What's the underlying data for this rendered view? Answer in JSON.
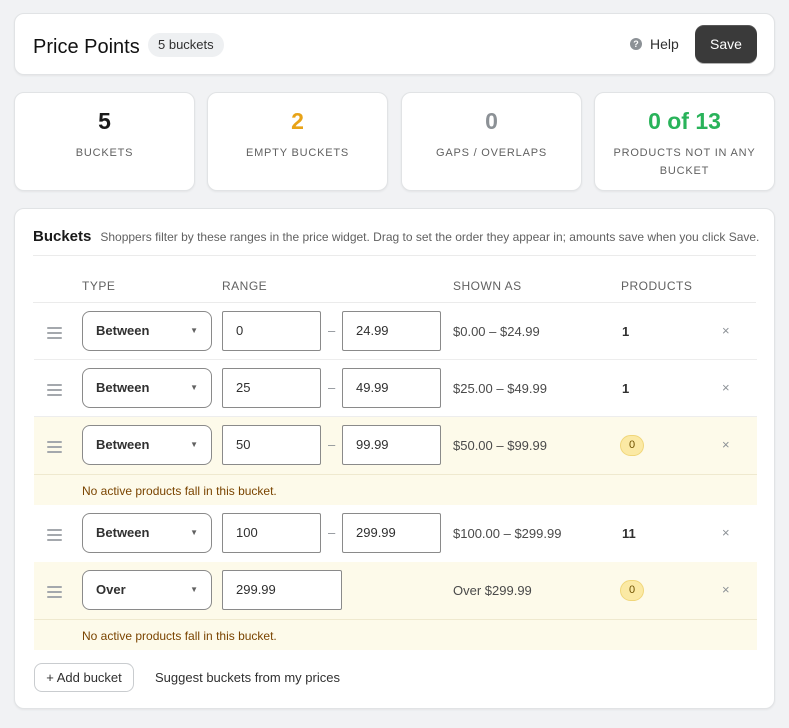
{
  "header": {
    "title": "Price Points",
    "badge": "5 buckets",
    "help_icon": "question-circle-icon",
    "help_label": "Help",
    "save_label": "Save"
  },
  "stats": [
    {
      "value": "5",
      "label": "BUCKETS",
      "color": "#1a1a1a"
    },
    {
      "value": "2",
      "label": "EMPTY BUCKETS",
      "color": "#e8a317"
    },
    {
      "value": "0",
      "label": "GAPS / OVERLAPS",
      "color": "#8c9196"
    },
    {
      "value": "0 of 13",
      "label": "PRODUCTS NOT IN ANY BUCKET",
      "color": "#29b35a"
    }
  ],
  "buckets": {
    "title": "Buckets",
    "subtitle": "Shoppers filter by these ranges in the price widget. Drag to set the order they appear in; amounts save when you click Save.",
    "columns": {
      "type": "TYPE",
      "range": "RANGE",
      "shown_as": "SHOWN AS",
      "products": "PRODUCTS"
    },
    "rows": [
      {
        "type": "Between",
        "min": "0",
        "dash": "–",
        "max": "24.99",
        "shown": "$0.00 – $24.99",
        "products": "1",
        "empty": false
      },
      {
        "type": "Between",
        "min": "25",
        "dash": "–",
        "max": "49.99",
        "shown": "$25.00 – $49.99",
        "products": "1",
        "empty": false
      },
      {
        "type": "Between",
        "min": "50",
        "dash": "–",
        "max": "99.99",
        "shown": "$50.00 – $99.99",
        "products": "0",
        "empty": true,
        "note": "No active products fall in this bucket."
      },
      {
        "type": "Between",
        "min": "100",
        "dash": "–",
        "max": "299.99",
        "shown": "$100.00 – $299.99",
        "products": "11",
        "empty": false
      },
      {
        "type": "Over",
        "min": "299.99",
        "shown": "Over $299.99",
        "products": "0",
        "empty": true,
        "note": "No active products fall in this bucket."
      }
    ],
    "delete_glyph": "×",
    "add_label": "+ Add bucket",
    "suggest_label": "Suggest buckets from my prices"
  }
}
